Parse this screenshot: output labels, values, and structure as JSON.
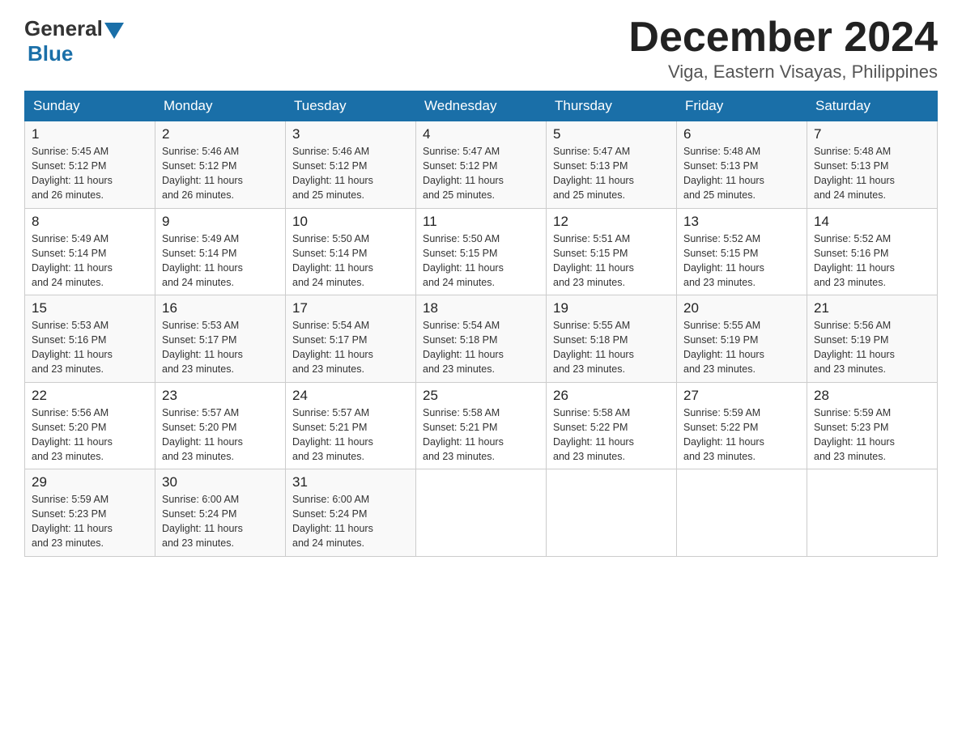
{
  "header": {
    "logo_general": "General",
    "logo_blue": "Blue",
    "month_title": "December 2024",
    "location": "Viga, Eastern Visayas, Philippines"
  },
  "weekdays": [
    "Sunday",
    "Monday",
    "Tuesday",
    "Wednesday",
    "Thursday",
    "Friday",
    "Saturday"
  ],
  "weeks": [
    [
      {
        "day": "1",
        "sunrise": "5:45 AM",
        "sunset": "5:12 PM",
        "daylight": "11 hours and 26 minutes."
      },
      {
        "day": "2",
        "sunrise": "5:46 AM",
        "sunset": "5:12 PM",
        "daylight": "11 hours and 26 minutes."
      },
      {
        "day": "3",
        "sunrise": "5:46 AM",
        "sunset": "5:12 PM",
        "daylight": "11 hours and 25 minutes."
      },
      {
        "day": "4",
        "sunrise": "5:47 AM",
        "sunset": "5:12 PM",
        "daylight": "11 hours and 25 minutes."
      },
      {
        "day": "5",
        "sunrise": "5:47 AM",
        "sunset": "5:13 PM",
        "daylight": "11 hours and 25 minutes."
      },
      {
        "day": "6",
        "sunrise": "5:48 AM",
        "sunset": "5:13 PM",
        "daylight": "11 hours and 25 minutes."
      },
      {
        "day": "7",
        "sunrise": "5:48 AM",
        "sunset": "5:13 PM",
        "daylight": "11 hours and 24 minutes."
      }
    ],
    [
      {
        "day": "8",
        "sunrise": "5:49 AM",
        "sunset": "5:14 PM",
        "daylight": "11 hours and 24 minutes."
      },
      {
        "day": "9",
        "sunrise": "5:49 AM",
        "sunset": "5:14 PM",
        "daylight": "11 hours and 24 minutes."
      },
      {
        "day": "10",
        "sunrise": "5:50 AM",
        "sunset": "5:14 PM",
        "daylight": "11 hours and 24 minutes."
      },
      {
        "day": "11",
        "sunrise": "5:50 AM",
        "sunset": "5:15 PM",
        "daylight": "11 hours and 24 minutes."
      },
      {
        "day": "12",
        "sunrise": "5:51 AM",
        "sunset": "5:15 PM",
        "daylight": "11 hours and 23 minutes."
      },
      {
        "day": "13",
        "sunrise": "5:52 AM",
        "sunset": "5:15 PM",
        "daylight": "11 hours and 23 minutes."
      },
      {
        "day": "14",
        "sunrise": "5:52 AM",
        "sunset": "5:16 PM",
        "daylight": "11 hours and 23 minutes."
      }
    ],
    [
      {
        "day": "15",
        "sunrise": "5:53 AM",
        "sunset": "5:16 PM",
        "daylight": "11 hours and 23 minutes."
      },
      {
        "day": "16",
        "sunrise": "5:53 AM",
        "sunset": "5:17 PM",
        "daylight": "11 hours and 23 minutes."
      },
      {
        "day": "17",
        "sunrise": "5:54 AM",
        "sunset": "5:17 PM",
        "daylight": "11 hours and 23 minutes."
      },
      {
        "day": "18",
        "sunrise": "5:54 AM",
        "sunset": "5:18 PM",
        "daylight": "11 hours and 23 minutes."
      },
      {
        "day": "19",
        "sunrise": "5:55 AM",
        "sunset": "5:18 PM",
        "daylight": "11 hours and 23 minutes."
      },
      {
        "day": "20",
        "sunrise": "5:55 AM",
        "sunset": "5:19 PM",
        "daylight": "11 hours and 23 minutes."
      },
      {
        "day": "21",
        "sunrise": "5:56 AM",
        "sunset": "5:19 PM",
        "daylight": "11 hours and 23 minutes."
      }
    ],
    [
      {
        "day": "22",
        "sunrise": "5:56 AM",
        "sunset": "5:20 PM",
        "daylight": "11 hours and 23 minutes."
      },
      {
        "day": "23",
        "sunrise": "5:57 AM",
        "sunset": "5:20 PM",
        "daylight": "11 hours and 23 minutes."
      },
      {
        "day": "24",
        "sunrise": "5:57 AM",
        "sunset": "5:21 PM",
        "daylight": "11 hours and 23 minutes."
      },
      {
        "day": "25",
        "sunrise": "5:58 AM",
        "sunset": "5:21 PM",
        "daylight": "11 hours and 23 minutes."
      },
      {
        "day": "26",
        "sunrise": "5:58 AM",
        "sunset": "5:22 PM",
        "daylight": "11 hours and 23 minutes."
      },
      {
        "day": "27",
        "sunrise": "5:59 AM",
        "sunset": "5:22 PM",
        "daylight": "11 hours and 23 minutes."
      },
      {
        "day": "28",
        "sunrise": "5:59 AM",
        "sunset": "5:23 PM",
        "daylight": "11 hours and 23 minutes."
      }
    ],
    [
      {
        "day": "29",
        "sunrise": "5:59 AM",
        "sunset": "5:23 PM",
        "daylight": "11 hours and 23 minutes."
      },
      {
        "day": "30",
        "sunrise": "6:00 AM",
        "sunset": "5:24 PM",
        "daylight": "11 hours and 23 minutes."
      },
      {
        "day": "31",
        "sunrise": "6:00 AM",
        "sunset": "5:24 PM",
        "daylight": "11 hours and 24 minutes."
      },
      null,
      null,
      null,
      null
    ]
  ],
  "labels": {
    "sunrise": "Sunrise:",
    "sunset": "Sunset:",
    "daylight": "Daylight:"
  }
}
